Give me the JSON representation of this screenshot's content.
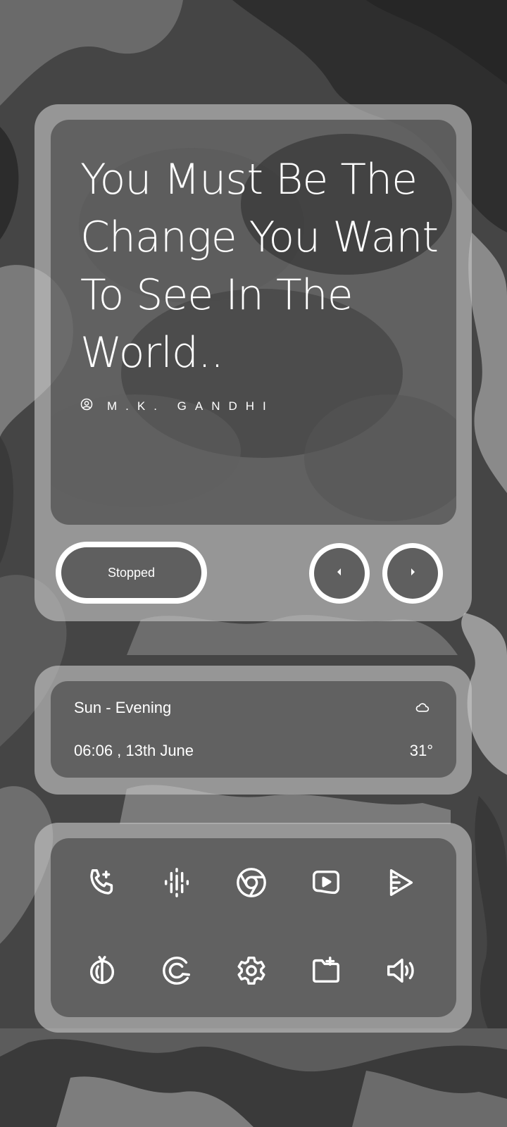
{
  "quote": {
    "text": "You Must Be The Change You Want To See In The World..",
    "author": "M.K. GANDHI"
  },
  "player": {
    "status": "Stopped",
    "prev_icon": "chevron-left-icon",
    "next_icon": "chevron-right-icon"
  },
  "info": {
    "day_period": "Sun - Evening",
    "datetime": "06:06 , 13th June",
    "temperature": "31°",
    "weather_icon": "cloud-icon"
  },
  "apps": [
    {
      "icon": "phone-icon"
    },
    {
      "icon": "podcasts-icon"
    },
    {
      "icon": "chrome-icon"
    },
    {
      "icon": "youtube-icon"
    },
    {
      "icon": "play-store-icon"
    },
    {
      "icon": "timer-icon"
    },
    {
      "icon": "c-app-icon"
    },
    {
      "icon": "settings-icon"
    },
    {
      "icon": "folder-add-icon"
    },
    {
      "icon": "volume-icon"
    }
  ],
  "colors": {
    "panel_outer": "#c8c8c8",
    "panel_inner": "#373737",
    "pill_inner": "#5f5f5f",
    "text": "#ffffff"
  }
}
